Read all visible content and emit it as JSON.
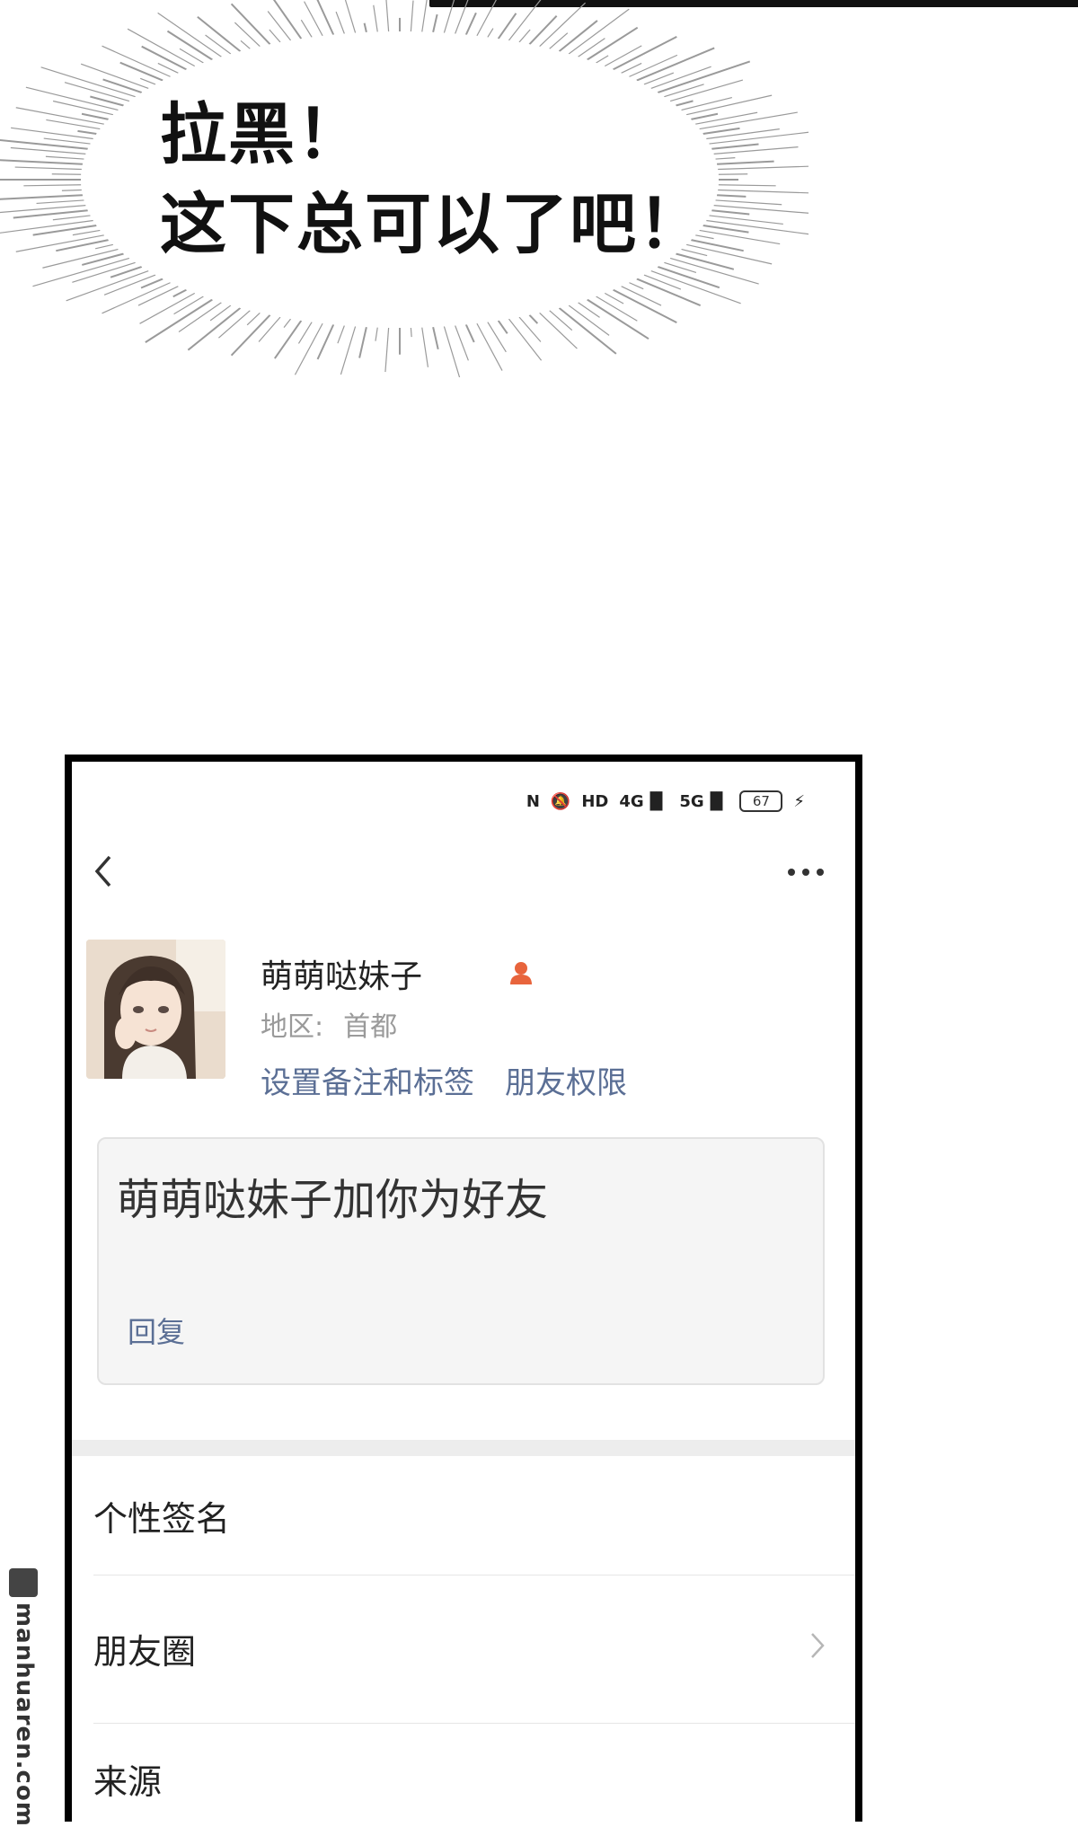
{
  "burst": {
    "line1": "拉黑！",
    "line2": "这下总可以了吧！"
  },
  "status_bar": {
    "icons": [
      "nfc-icon",
      "mute-icon",
      "hd-icon",
      "signal-4g-icon",
      "signal-5g-icon"
    ],
    "labels": {
      "hd": "HD",
      "net1": "4G",
      "net2": "5G"
    },
    "battery": "67"
  },
  "nav": {
    "back_icon": "chevron-left-icon",
    "more_icon": "more-dots-icon"
  },
  "profile": {
    "name": "萌萌哒妹子",
    "region_label": "地区:",
    "region_value": "首都",
    "link_remark": "设置备注和标签",
    "link_permission": "朋友权限",
    "gender_icon_color": "#e8643c"
  },
  "request": {
    "message": "萌萌哒妹子加你为好友",
    "reply_label": "回复"
  },
  "rows": [
    {
      "label": "个性签名"
    },
    {
      "label": "朋友圈"
    },
    {
      "label": "来源"
    }
  ],
  "watermark": {
    "text": "manhuaren.com"
  },
  "colors": {
    "link": "#5b6f95",
    "card_bg": "#f5f5f5"
  }
}
